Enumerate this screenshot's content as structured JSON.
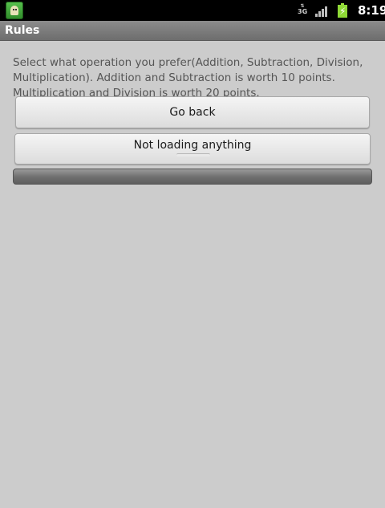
{
  "status_bar": {
    "network_type": "3G",
    "time": "8:19"
  },
  "title_bar": {
    "title": "Rules"
  },
  "main": {
    "description": "Select what operation you prefer(Addition, Subtraction, Division, Multiplication). Addition and Subtraction is worth 10 points. Multiplication and Division is worth 20 points.",
    "go_back_label": "Go back",
    "loading_label": "Not loading anything",
    "progress": 0
  },
  "icons": {
    "app": "app-icon",
    "network": "3g-icon",
    "signal": "signal-icon",
    "battery": "battery-charging-icon"
  }
}
